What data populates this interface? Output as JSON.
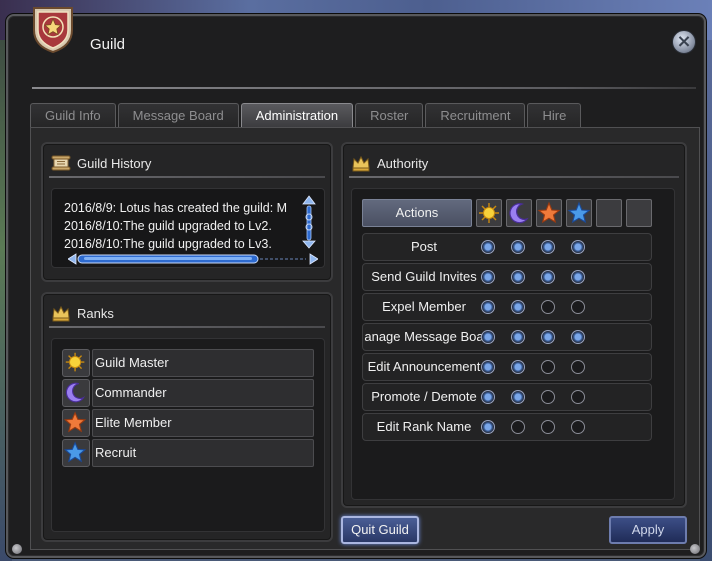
{
  "window": {
    "title": "Guild"
  },
  "tabs": [
    {
      "label": "Guild Info",
      "active": false
    },
    {
      "label": "Message Board",
      "active": false
    },
    {
      "label": "Administration",
      "active": true
    },
    {
      "label": "Roster",
      "active": false
    },
    {
      "label": "Recruitment",
      "active": false
    },
    {
      "label": "Hire",
      "active": false
    }
  ],
  "history": {
    "title": "Guild History",
    "entries": [
      "2016/8/9: Lotus has created the guild: M",
      "2016/8/10:The guild upgraded to Lv2.",
      "2016/8/10:The guild upgraded to Lv3."
    ]
  },
  "ranks": {
    "title": "Ranks",
    "items": [
      {
        "name": "Guild Master",
        "icon": "sun-icon",
        "color": "#f2c230"
      },
      {
        "name": "Commander",
        "icon": "moon-icon",
        "color": "#8a6fe0"
      },
      {
        "name": "Elite Member",
        "icon": "star-icon",
        "color": "#f07a3a"
      },
      {
        "name": "Recruit",
        "icon": "star-icon",
        "color": "#3a8de0"
      }
    ]
  },
  "authority": {
    "title": "Authority",
    "header_label": "Actions",
    "columns": [
      "sun-icon",
      "moon-icon",
      "orange-star-icon",
      "blue-star-icon",
      "empty",
      "empty"
    ],
    "rows": [
      {
        "label": "Post",
        "values": [
          true,
          true,
          true,
          true
        ]
      },
      {
        "label": "Send Guild Invites",
        "values": [
          true,
          true,
          true,
          true
        ]
      },
      {
        "label": "Expel Member",
        "values": [
          true,
          true,
          false,
          false
        ]
      },
      {
        "label": "anage Message Boa",
        "values": [
          true,
          true,
          true,
          true
        ]
      },
      {
        "label": "Edit Announcement",
        "values": [
          true,
          true,
          false,
          false
        ]
      },
      {
        "label": "Promote / Demote",
        "values": [
          true,
          true,
          false,
          false
        ]
      },
      {
        "label": "Edit Rank Name",
        "values": [
          true,
          false,
          false,
          false
        ]
      }
    ]
  },
  "buttons": {
    "quit": "Quit Guild",
    "apply": "Apply"
  }
}
